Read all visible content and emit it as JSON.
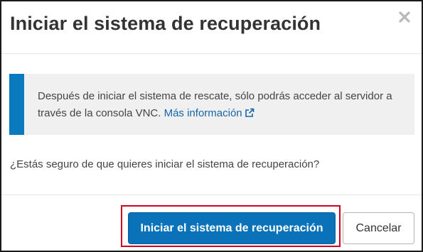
{
  "dialog": {
    "title": "Iniciar el sistema de recuperación",
    "close_icon": "close-icon"
  },
  "alert": {
    "text": "Después de iniciar el sistema de rescate, sólo podrás acceder al servidor a través de la consola VNC.",
    "link_label": "Más información",
    "link_icon": "external-link-icon",
    "accent_color": "#0a7abf"
  },
  "question": "¿Estás seguro de que quieres iniciar el sistema de recuperación?",
  "buttons": {
    "confirm_label": "Iniciar el sistema de recuperación",
    "cancel_label": "Cancelar",
    "primary_color": "#0a72b8",
    "highlight_color": "#d0021b"
  }
}
